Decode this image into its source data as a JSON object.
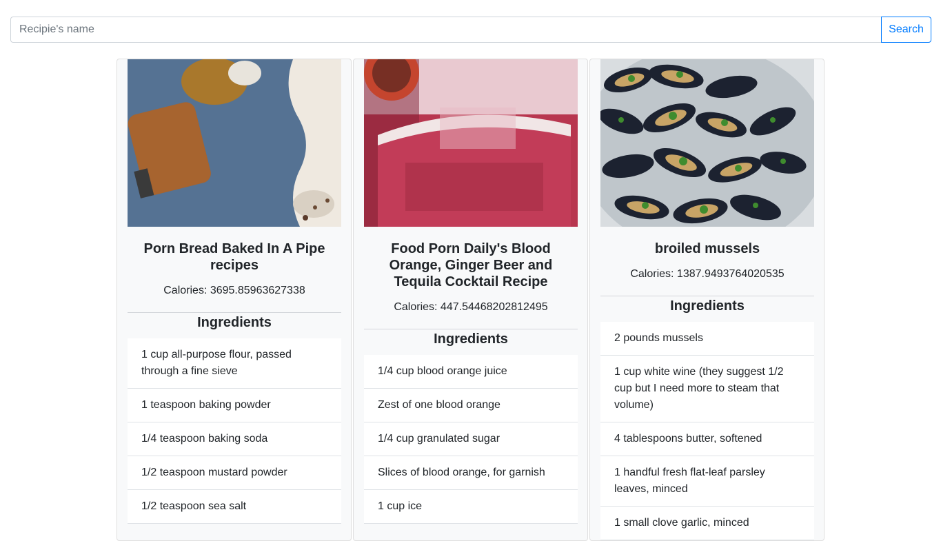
{
  "search": {
    "placeholder": "Recipie's name",
    "button_label": "Search"
  },
  "recipes": [
    {
      "title": "Porn Bread Baked In A Pipe recipes",
      "calories": "Calories: 3695.85963627338",
      "ingredients_heading": "Ingredients",
      "ingredients": [
        "1 cup all-purpose flour, passed through a fine sieve",
        "1 teaspoon baking powder",
        "1/4 teaspoon baking soda",
        "1/2 teaspoon mustard powder",
        "1/2 teaspoon sea salt"
      ]
    },
    {
      "title": "Food Porn Daily's Blood Orange, Ginger Beer and Tequila Cocktail Recipe",
      "calories": "Calories: 447.54468202812495",
      "ingredients_heading": "Ingredients",
      "ingredients": [
        "1/4 cup blood orange juice",
        "Zest of one blood orange",
        "1/4 cup granulated sugar",
        "Slices of blood orange, for garnish",
        "1 cup ice"
      ]
    },
    {
      "title": "broiled mussels",
      "calories": "Calories: 1387.9493764020535",
      "ingredients_heading": "Ingredients",
      "ingredients": [
        "2 pounds mussels",
        "1 cup white wine (they suggest 1/2 cup but I need more to steam that volume)",
        "4 tablespoons butter, softened",
        "1 handful fresh flat-leaf parsley leaves, minced",
        "1 small clove garlic, minced"
      ]
    }
  ]
}
